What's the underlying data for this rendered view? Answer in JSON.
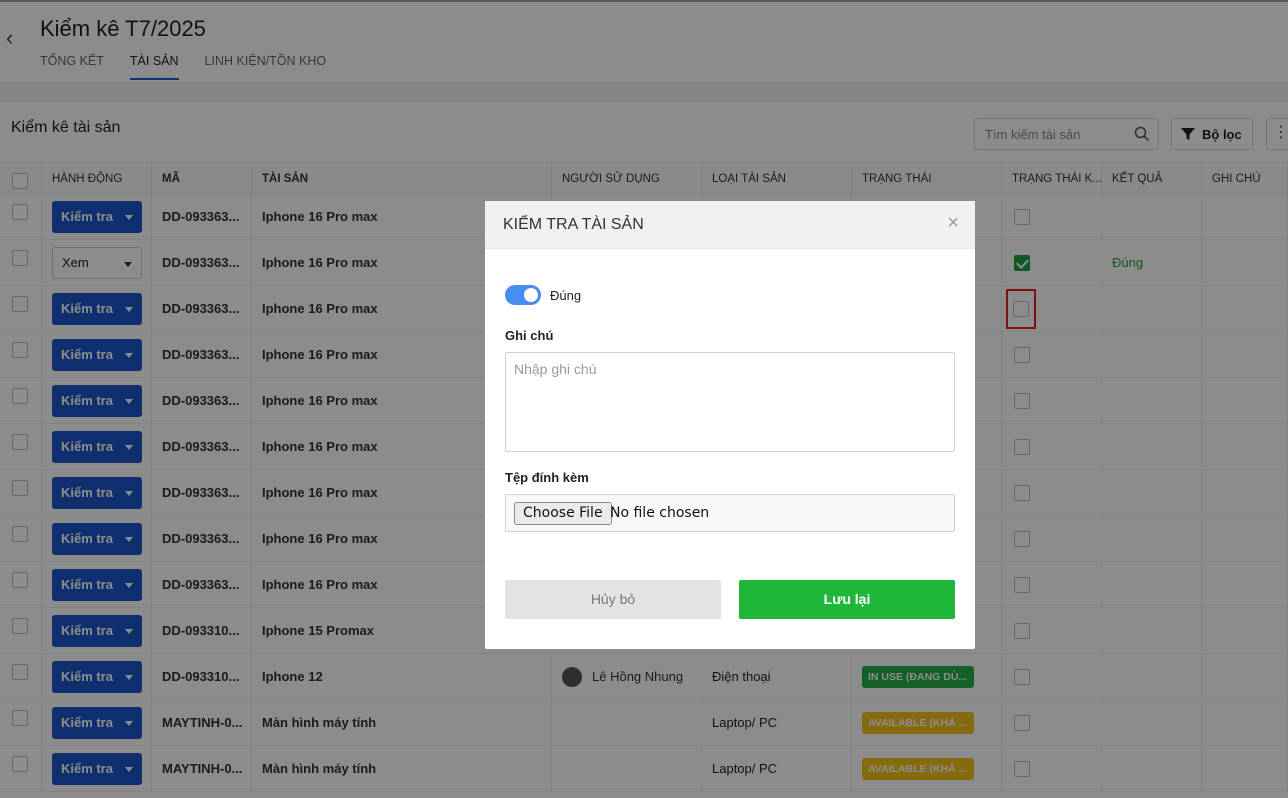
{
  "header": {
    "title": "Kiểm kê T7/2025",
    "tabs": [
      {
        "label": "TỔNG KẾT",
        "active": false
      },
      {
        "label": "TÀI SẢN",
        "active": true
      },
      {
        "label": "LINH KIỆN/TỒN KHO",
        "active": false
      }
    ]
  },
  "panel": {
    "title": "Kiểm kê tài sản",
    "search_placeholder": "Tìm kiếm tài sản",
    "filter_label": "Bộ lọc"
  },
  "table": {
    "columns": [
      "HÀNH ĐỘNG",
      "MÃ",
      "TÀI SẢN",
      "NGƯỜI SỬ DỤNG",
      "LOẠI TÀI SẢN",
      "TRẠNG THÁI",
      "TRẠNG THÁI K...",
      "KẾT QUẢ",
      "GHI CHÚ"
    ],
    "rows": [
      {
        "action": "Kiểm tra",
        "action_type": "check",
        "code": "DD-093363...",
        "asset": "Iphone 16 Pro max",
        "user": "",
        "type": "",
        "status": "",
        "status_type": "",
        "checked": false,
        "result": "",
        "note": ""
      },
      {
        "action": "Xem",
        "action_type": "view",
        "code": "DD-093363...",
        "asset": "Iphone 16 Pro max",
        "user": "",
        "type": "",
        "status": "",
        "status_type": "",
        "checked": true,
        "result": "Đúng",
        "note": ""
      },
      {
        "action": "Kiểm tra",
        "action_type": "check",
        "code": "DD-093363...",
        "asset": "Iphone 16 Pro max",
        "user": "",
        "type": "",
        "status": "",
        "status_type": "",
        "checked": false,
        "highlight": true,
        "result": "",
        "note": ""
      },
      {
        "action": "Kiểm tra",
        "action_type": "check",
        "code": "DD-093363...",
        "asset": "Iphone 16 Pro max",
        "user": "",
        "type": "",
        "status": "",
        "status_type": "",
        "checked": false,
        "result": "",
        "note": ""
      },
      {
        "action": "Kiểm tra",
        "action_type": "check",
        "code": "DD-093363...",
        "asset": "Iphone 16 Pro max",
        "user": "",
        "type": "",
        "status": "",
        "status_type": "",
        "checked": false,
        "result": "",
        "note": ""
      },
      {
        "action": "Kiểm tra",
        "action_type": "check",
        "code": "DD-093363...",
        "asset": "Iphone 16 Pro max",
        "user": "",
        "type": "",
        "status": "",
        "status_type": "",
        "checked": false,
        "result": "",
        "note": ""
      },
      {
        "action": "Kiểm tra",
        "action_type": "check",
        "code": "DD-093363...",
        "asset": "Iphone 16 Pro max",
        "user": "",
        "type": "",
        "status": "",
        "status_type": "",
        "checked": false,
        "result": "",
        "note": ""
      },
      {
        "action": "Kiểm tra",
        "action_type": "check",
        "code": "DD-093363...",
        "asset": "Iphone 16 Pro max",
        "user": "",
        "type": "",
        "status": "",
        "status_type": "",
        "checked": false,
        "result": "",
        "note": ""
      },
      {
        "action": "Kiểm tra",
        "action_type": "check",
        "code": "DD-093363...",
        "asset": "Iphone 16 Pro max",
        "user": "",
        "type": "",
        "status": "",
        "status_type": "",
        "checked": false,
        "result": "",
        "note": ""
      },
      {
        "action": "Kiểm tra",
        "action_type": "check",
        "code": "DD-093310...",
        "asset": "Iphone 15 Promax",
        "user": "",
        "type": "",
        "status": "",
        "status_type": "",
        "checked": false,
        "result": "",
        "note": ""
      },
      {
        "action": "Kiểm tra",
        "action_type": "check",
        "code": "DD-093310...",
        "asset": "Iphone 12",
        "user": "Lê Hồng Nhung",
        "type": "Điện thoại",
        "status": "IN USE (ĐANG DÙ...",
        "status_type": "in-use",
        "checked": false,
        "result": "",
        "note": ""
      },
      {
        "action": "Kiểm tra",
        "action_type": "check",
        "code": "MAYTINH-0...",
        "asset": "Màn hình máy tính",
        "user": "",
        "type": "Laptop/ PC",
        "status": "AVAILABLE (KHẢ ...",
        "status_type": "available",
        "checked": false,
        "result": "",
        "note": ""
      },
      {
        "action": "Kiểm tra",
        "action_type": "check",
        "code": "MAYTINH-0...",
        "asset": "Màn hình máy tính",
        "user": "",
        "type": "Laptop/ PC",
        "status": "AVAILABLE (KHẢ ...",
        "status_type": "available",
        "checked": false,
        "result": "",
        "note": ""
      }
    ]
  },
  "modal": {
    "title": "KIỂM TRA TÀI SẢN",
    "close_symbol": "×",
    "toggle_label": "Đúng",
    "toggle_on": true,
    "note_label": "Ghi chú",
    "note_placeholder": "Nhập ghi chú",
    "attach_label": "Tệp đính kèm",
    "file_button": "Choose File",
    "file_status": "No file chosen",
    "cancel_label": "Hủy bỏ",
    "save_label": "Lưu lại"
  },
  "colors": {
    "primary_blue": "#1e56c8",
    "success_green": "#20b83a",
    "status_in_use": "#26b04a",
    "status_available": "#f2c21b",
    "highlight_red": "#e02020"
  },
  "icons": {
    "back": "chevron-left-icon",
    "search": "search-icon",
    "filter": "filter-icon",
    "more": "more-vertical-icon",
    "close": "close-icon"
  }
}
